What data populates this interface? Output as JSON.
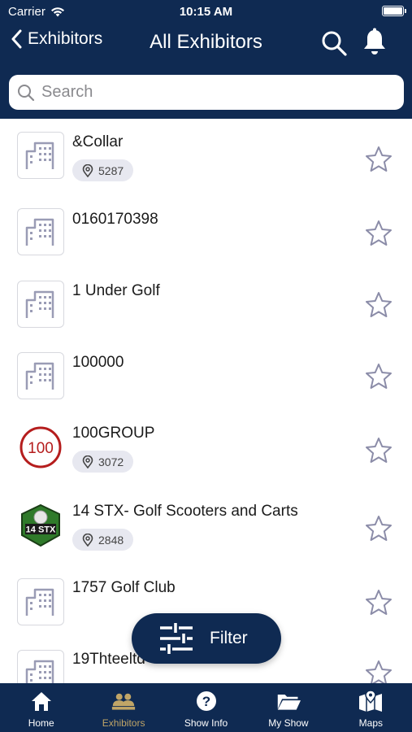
{
  "status": {
    "carrier": "Carrier",
    "time": "10:15 AM"
  },
  "nav": {
    "back_label": "Exhibitors",
    "title": "All Exhibitors"
  },
  "search": {
    "placeholder": "Search"
  },
  "exhibitors": [
    {
      "name": "&Collar",
      "booth": "5287",
      "logo": "placeholder-building-icon",
      "favorite": false
    },
    {
      "name": "0160170398",
      "booth": null,
      "logo": "placeholder-building-icon",
      "favorite": false
    },
    {
      "name": "1 Under Golf",
      "booth": null,
      "logo": "placeholder-building-icon",
      "favorite": false
    },
    {
      "name": "100000",
      "booth": null,
      "logo": "placeholder-building-icon",
      "favorite": false
    },
    {
      "name": "100GROUP",
      "booth": "3072",
      "logo": "100group-logo",
      "logo_text": "100",
      "favorite": false
    },
    {
      "name": "14 STX- Golf Scooters and Carts",
      "booth": "2848",
      "logo": "14stx-logo",
      "logo_text": "14 STX",
      "favorite": false
    },
    {
      "name": "1757 Golf Club",
      "booth": null,
      "logo": "placeholder-building-icon",
      "favorite": false
    },
    {
      "name": "19Thteeltd",
      "booth": null,
      "logo": "placeholder-building-icon",
      "favorite": false
    }
  ],
  "filter_button": {
    "label": "Filter"
  },
  "tabbar": [
    {
      "label": "Home",
      "icon": "home-icon",
      "active": false
    },
    {
      "label": "Exhibitors",
      "icon": "exhibitors-icon",
      "active": true
    },
    {
      "label": "Show Info",
      "icon": "question-icon",
      "active": false
    },
    {
      "label": "My Show",
      "icon": "folder-icon",
      "active": false
    },
    {
      "label": "Maps",
      "icon": "map-icon",
      "active": false
    }
  ],
  "colors": {
    "header": "#0f2a52",
    "active_tab": "#c0a567",
    "star": "#8b8ca8",
    "booth_pill": "#e7e8f0"
  }
}
